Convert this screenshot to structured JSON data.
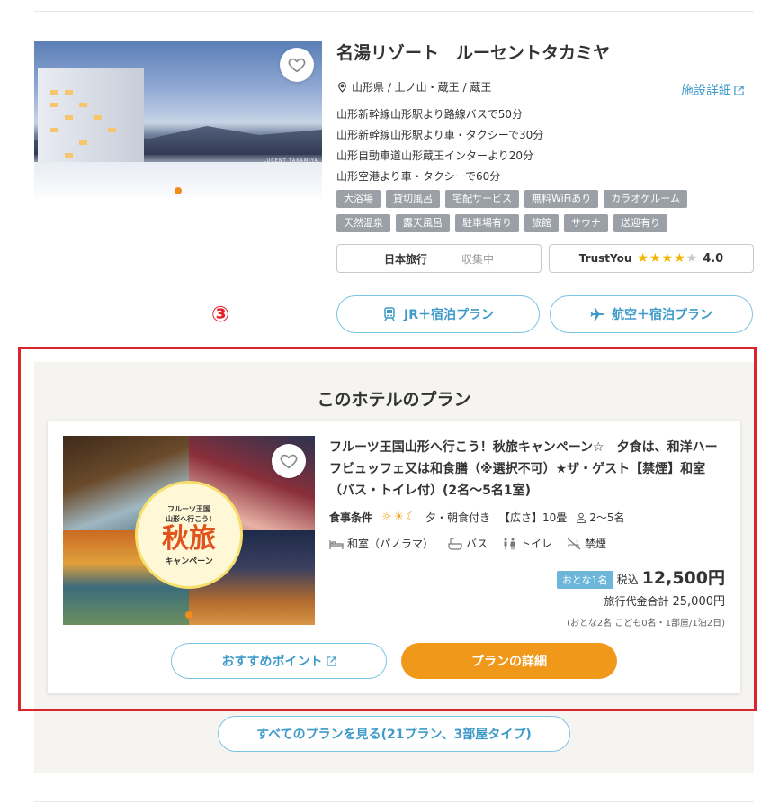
{
  "hotel": {
    "image_caption": "LUCENT TAKAMIYA",
    "name": "名湯リゾート　ルーセントタカミヤ",
    "location": "山形県 / 上ノ山・蔵王 / 蔵王",
    "detail_link": "施設詳細",
    "access": [
      "山形新幹線山形駅より路線バスで50分",
      "山形新幹線山形駅より車・タクシーで30分",
      "山形自動車道山形蔵王インターより20分",
      "山形空港より車・タクシーで60分"
    ],
    "tags": [
      "大浴場",
      "貸切風呂",
      "宅配サービス",
      "無料WiFiあり",
      "カラオケルーム",
      "天然温泉",
      "露天風呂",
      "駐車場有り",
      "旅館",
      "サウナ",
      "送迎有り"
    ],
    "ratings": {
      "nippon_travel": {
        "label": "日本旅行",
        "status": "収集中"
      },
      "trustyou": {
        "label": "TrustYou",
        "stars": 4,
        "score": "4.0"
      }
    },
    "buttons": {
      "jr": "JR＋宿泊プラン",
      "air": "航空＋宿泊プラン"
    }
  },
  "annotation_marker": "③",
  "plans": {
    "heading": "このホテルのプラン",
    "plan": {
      "image_badge": {
        "top": "フルーツ王国",
        "middle": "山形へ行こう!",
        "big": "秋旅",
        "bottom": "キャンペーン"
      },
      "title": "フルーツ王国山形へ行こう！秋旅キャンペーン☆　夕食は、和洋ハーフビュッフェ又は和食膳（※選択不可）★ザ・ゲスト【禁煙】和室（バス・トイレ付）(2名～5名1室)",
      "meal_label": "食事条件",
      "meal_value": "夕・朝食付き",
      "size": "【広さ】10畳",
      "capacity": "2～5名",
      "amenities": [
        "和室（パノラマ）",
        "バス",
        "トイレ",
        "禁煙"
      ],
      "adult_badge": "おとな1名",
      "tax_label": "税込",
      "price": "12,500円",
      "total_label": "旅行代金合計",
      "total_value": "25,000円",
      "breakdown": "(おとな2名 こども0名・1部屋/1泊2日)",
      "recommend_button": "おすすめポイント",
      "detail_button": "プランの詳細"
    },
    "all_plans_button": "すべてのプランを見る(21プラン、3部屋タイプ)"
  },
  "colors": {
    "accent_blue": "#3d9ac9",
    "orange": "#f0981a",
    "frame_red": "#d9252b",
    "tag_gray": "#9aa0a6"
  }
}
